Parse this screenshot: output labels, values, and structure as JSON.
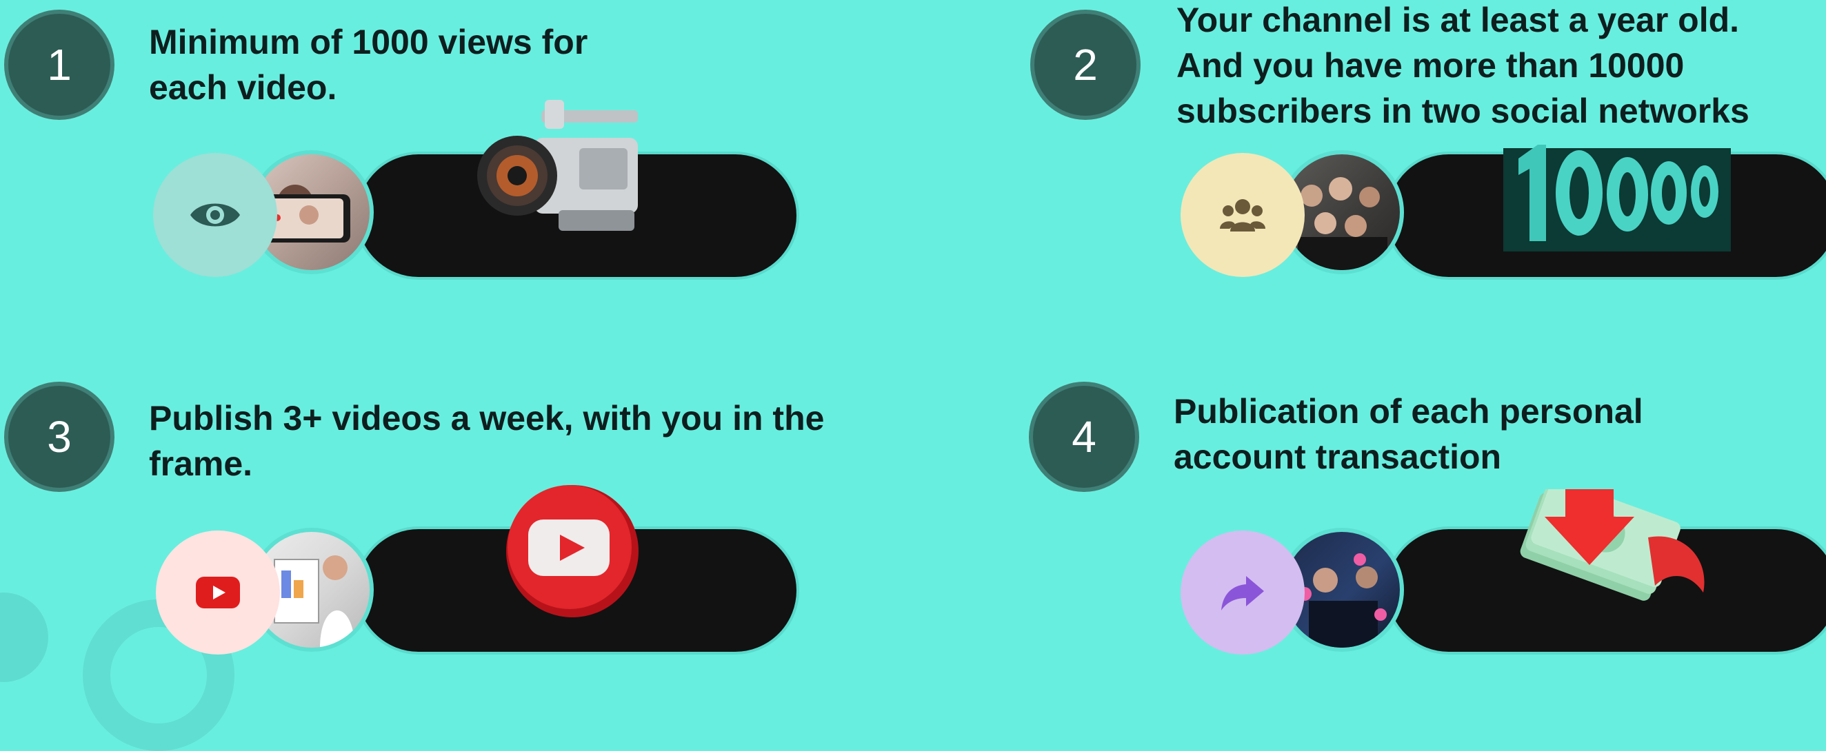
{
  "colors": {
    "background": "#68EEDF",
    "number_circle": "#2D5C55",
    "pill": "#121212"
  },
  "cards": [
    {
      "number": "1",
      "title": " Minimum of 1000 views for\neach video.",
      "icon": "eye-icon",
      "icon_bg": "#9EDFD6",
      "object": "video-camera"
    },
    {
      "number": "2",
      "title": "Your channel is at least a year old.\nAnd you have more than 10000\nsubscribers in two social networks",
      "icon": "users-icon",
      "icon_bg": "#F3E7B7",
      "object": "10000-3d-number"
    },
    {
      "number": "3",
      "title": " Publish 3+ videos a week, with you in the\nframe.",
      "icon": "youtube-icon",
      "icon_bg": "#FFE3E1",
      "object": "youtube-3d-button"
    },
    {
      "number": "4",
      "title": " Publication of each personal\naccount transaction",
      "icon": "share-arrow-icon",
      "icon_bg": "#D4BDF0",
      "object": "money-stack"
    }
  ]
}
